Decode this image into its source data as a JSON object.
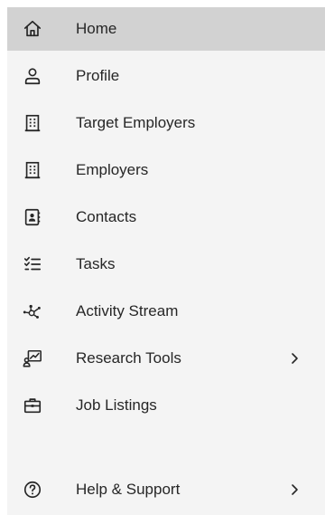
{
  "nav": {
    "items": [
      {
        "label": "Home",
        "icon": "home-icon",
        "active": true
      },
      {
        "label": "Profile",
        "icon": "user-icon"
      },
      {
        "label": "Target Employers",
        "icon": "building-icon"
      },
      {
        "label": "Employers",
        "icon": "building-icon"
      },
      {
        "label": "Contacts",
        "icon": "contact-card-icon"
      },
      {
        "label": "Tasks",
        "icon": "checklist-icon"
      },
      {
        "label": "Activity Stream",
        "icon": "network-icon"
      },
      {
        "label": "Research Tools",
        "icon": "research-chart-icon",
        "has_submenu": true
      },
      {
        "label": "Job Listings",
        "icon": "briefcase-icon"
      },
      {
        "label": "Help & Support",
        "icon": "help-circle-icon",
        "has_submenu": true
      }
    ]
  },
  "colors": {
    "panel_bg": "#f4f4f4",
    "active_bg": "#d2d2d2",
    "text": "#262626",
    "icon": "#262626"
  }
}
